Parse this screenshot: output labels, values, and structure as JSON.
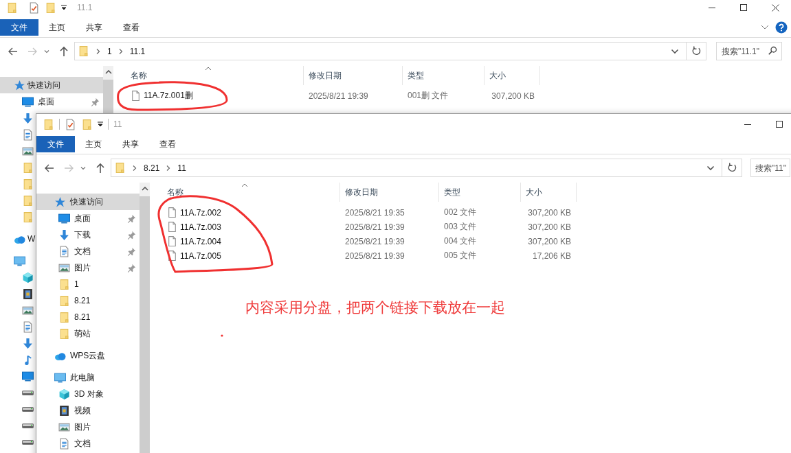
{
  "windows": [
    {
      "title": "11.1",
      "window_buttons": [
        {
          "kind": "minimize"
        },
        {
          "kind": "maximize"
        },
        {
          "kind": "close"
        }
      ],
      "ribbon_help": true,
      "ribbon_tabs": [
        {
          "label": "文件",
          "selected": true
        },
        {
          "label": "主页",
          "selected": false
        },
        {
          "label": "共享",
          "selected": false
        },
        {
          "label": "查看",
          "selected": false
        }
      ],
      "path": [
        "1",
        "11.1"
      ],
      "search": {
        "placeholder": "搜索\"11.1\""
      },
      "sidebar": {
        "items": [
          {
            "kind": "star",
            "label": "快速访问",
            "selected": true,
            "children": [
              {
                "kind": "desktop",
                "label": "桌面",
                "pinned": true,
                "selected": false
              },
              {
                "kind": "download",
                "selected": false
              },
              {
                "kind": "docs",
                "selected": false
              },
              {
                "kind": "pictures",
                "selected": false
              },
              {
                "kind": "folder",
                "selected": false
              },
              {
                "kind": "folder",
                "selected": false
              },
              {
                "kind": "folder",
                "selected": false
              },
              {
                "kind": "folder",
                "selected": false
              }
            ]
          },
          {
            "kind": "cloud",
            "label": "W",
            "selected": false
          },
          {
            "kind": "pc",
            "selected": false,
            "children": [
              {
                "kind": "cube",
                "selected": false
              },
              {
                "kind": "video",
                "selected": false
              },
              {
                "kind": "pictures",
                "selected": false
              },
              {
                "kind": "docs",
                "selected": false
              },
              {
                "kind": "download",
                "selected": false
              },
              {
                "kind": "music",
                "selected": false
              },
              {
                "kind": "desktop",
                "selected": false
              },
              {
                "kind": "drive",
                "selected": false
              },
              {
                "kind": "drive",
                "selected": false
              },
              {
                "kind": "drive",
                "selected": false
              },
              {
                "kind": "drive",
                "selected": false
              }
            ]
          }
        ]
      },
      "columns": [
        {
          "label": "名称",
          "sorted": true
        },
        {
          "label": "修改日期",
          "sorted": false
        },
        {
          "label": "类型",
          "sorted": false
        },
        {
          "label": "大小",
          "sorted": false
        }
      ],
      "files": [
        {
          "name": "11A.7z.001删",
          "modified": "2025/8/21 19:39",
          "type": "001删 文件",
          "size": "307,200 KB"
        }
      ]
    },
    {
      "title": "11",
      "window_buttons": [
        {
          "kind": "minimize"
        },
        {
          "kind": "maximize"
        }
      ],
      "ribbon_tabs": [
        {
          "label": "文件",
          "selected": true
        },
        {
          "label": "主页",
          "selected": false
        },
        {
          "label": "共享",
          "selected": false
        },
        {
          "label": "查看",
          "selected": false
        }
      ],
      "path": [
        "8.21",
        "11"
      ],
      "search": {
        "placeholder": "搜索\"11\""
      },
      "sidebar": {
        "items": [
          {
            "kind": "star",
            "label": "快速访问",
            "selected": true,
            "children": [
              {
                "kind": "desktop",
                "label": "桌面",
                "pinned": true,
                "selected": false
              },
              {
                "kind": "download",
                "label": "下载",
                "pinned": true,
                "selected": false
              },
              {
                "kind": "docs",
                "label": "文档",
                "pinned": true,
                "selected": false
              },
              {
                "kind": "pictures",
                "label": "图片",
                "pinned": true,
                "selected": false
              },
              {
                "kind": "folder",
                "label": "1",
                "pinned": false,
                "selected": false
              },
              {
                "kind": "folder",
                "label": "8.21",
                "pinned": false,
                "selected": false
              },
              {
                "kind": "folder",
                "label": "8.21",
                "pinned": false,
                "selected": false
              },
              {
                "kind": "folder",
                "label": "萌站",
                "pinned": false,
                "selected": false
              }
            ]
          },
          {
            "kind": "cloud",
            "label": "WPS云盘",
            "selected": false
          },
          {
            "kind": "pc",
            "label": "此电脑",
            "selected": false,
            "children": [
              {
                "kind": "cube",
                "label": "3D 对象",
                "selected": false
              },
              {
                "kind": "video",
                "label": "视频",
                "selected": false
              },
              {
                "kind": "pictures",
                "label": "图片",
                "selected": false
              },
              {
                "kind": "docs",
                "label": "文档",
                "selected": false
              }
            ]
          }
        ]
      },
      "columns": [
        {
          "label": "名称",
          "sorted": true
        },
        {
          "label": "修改日期",
          "sorted": false
        },
        {
          "label": "类型",
          "sorted": false
        },
        {
          "label": "大小",
          "sorted": false
        }
      ],
      "files": [
        {
          "name": "11A.7z.002",
          "modified": "2025/8/21 19:35",
          "type": "002 文件",
          "size": "307,200 KB"
        },
        {
          "name": "11A.7z.003",
          "modified": "2025/8/21 19:39",
          "type": "003 文件",
          "size": "307,200 KB"
        },
        {
          "name": "11A.7z.004",
          "modified": "2025/8/21 19:39",
          "type": "004 文件",
          "size": "307,200 KB"
        },
        {
          "name": "11A.7z.005",
          "modified": "2025/8/21 19:39",
          "type": "005 文件",
          "size": "17,206 KB"
        }
      ]
    }
  ],
  "annotation": {
    "text": "内容采用分盘，把两个链接下载放在一起"
  }
}
